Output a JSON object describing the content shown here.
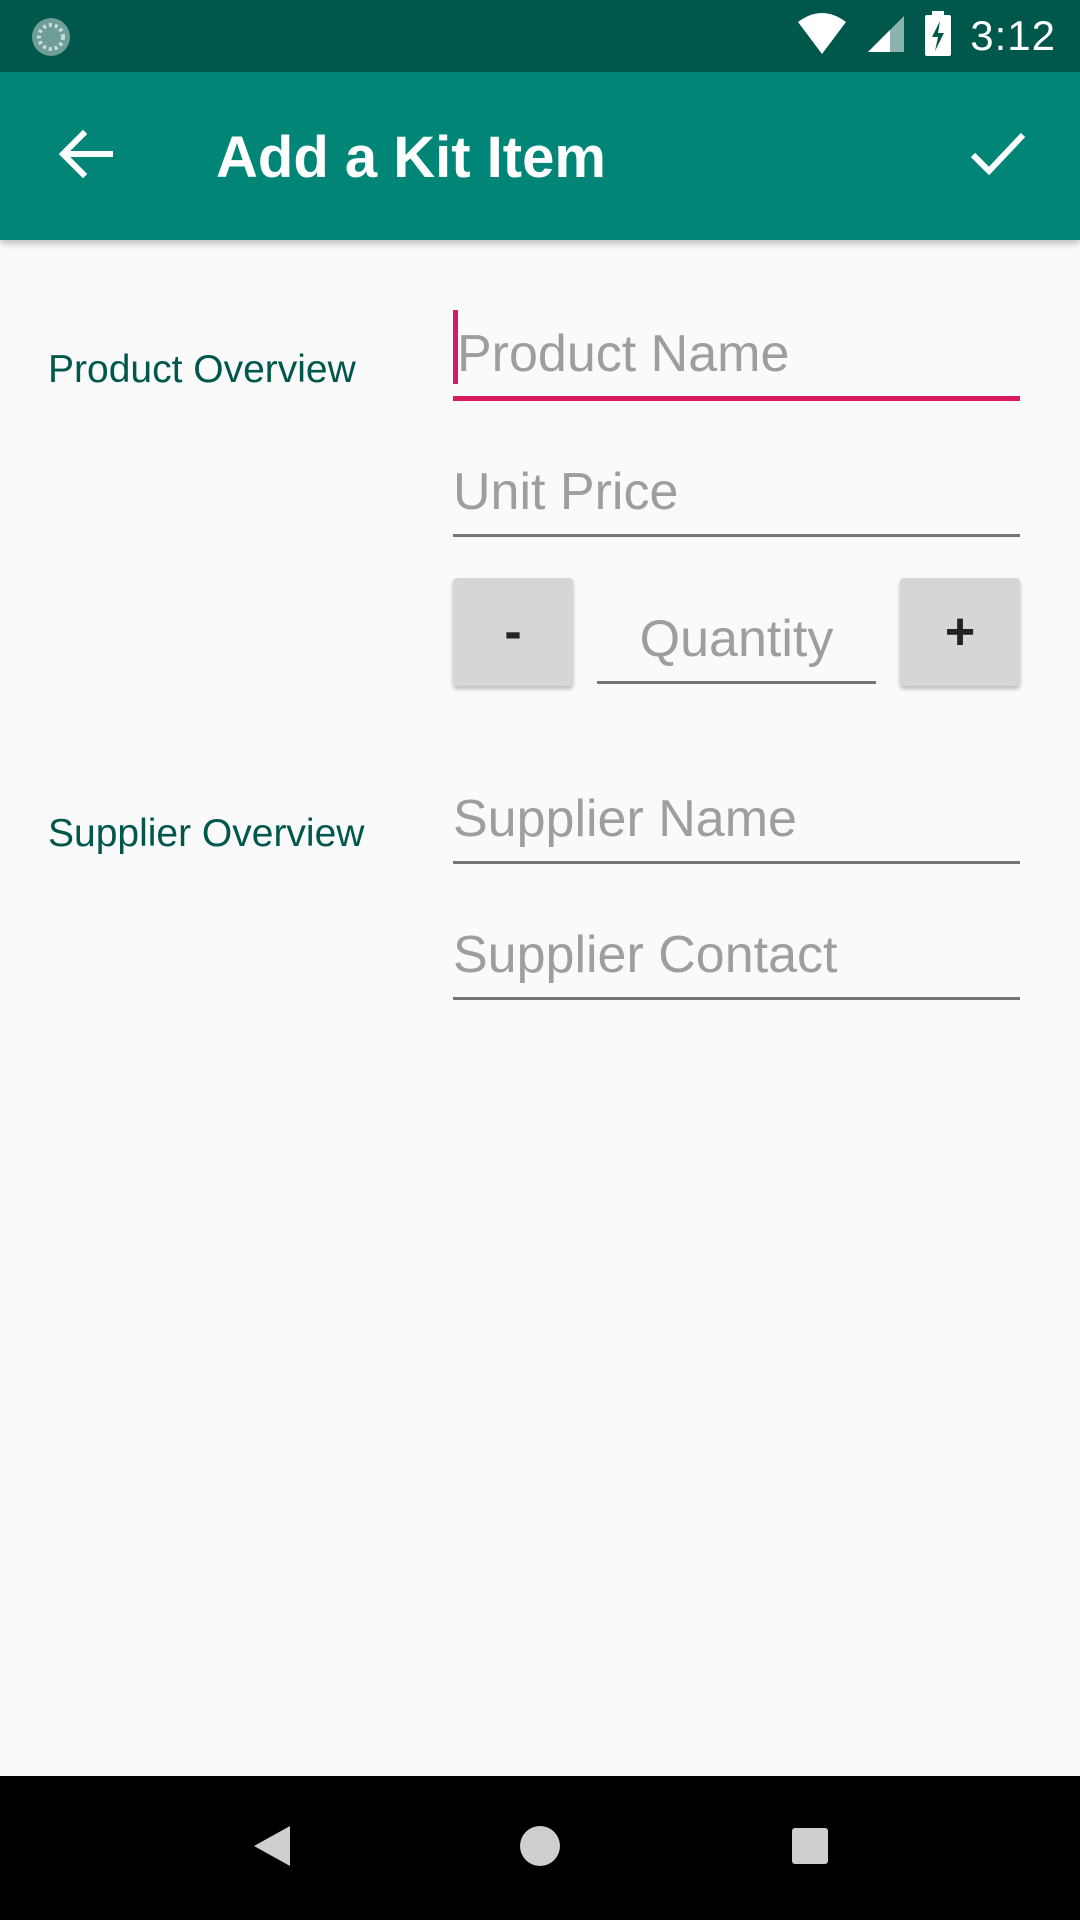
{
  "status_bar": {
    "time": "3:12",
    "icons": [
      "sync-icon",
      "wifi-icon",
      "signal-icon",
      "battery-charging-icon"
    ]
  },
  "app_bar": {
    "title": "Add a Kit Item",
    "back_icon": "arrow-back-icon",
    "confirm_icon": "check-icon",
    "background_color": "#008577",
    "status_color": "#00574b"
  },
  "product_section": {
    "label": "Product Overview",
    "product_name": {
      "placeholder": "Product Name",
      "value": ""
    },
    "unit_price": {
      "placeholder": "Unit Price",
      "value": ""
    },
    "quantity": {
      "placeholder": "Quantity",
      "value": "",
      "decrement_label": "-",
      "increment_label": "+"
    }
  },
  "supplier_section": {
    "label": "Supplier Overview",
    "supplier_name": {
      "placeholder": "Supplier Name",
      "value": ""
    },
    "supplier_contact": {
      "placeholder": "Supplier Contact",
      "value": ""
    }
  },
  "accent_color": "#d81b60",
  "nav_bar": {
    "icons": [
      "back-triangle-icon",
      "home-circle-icon",
      "recents-square-icon"
    ]
  }
}
